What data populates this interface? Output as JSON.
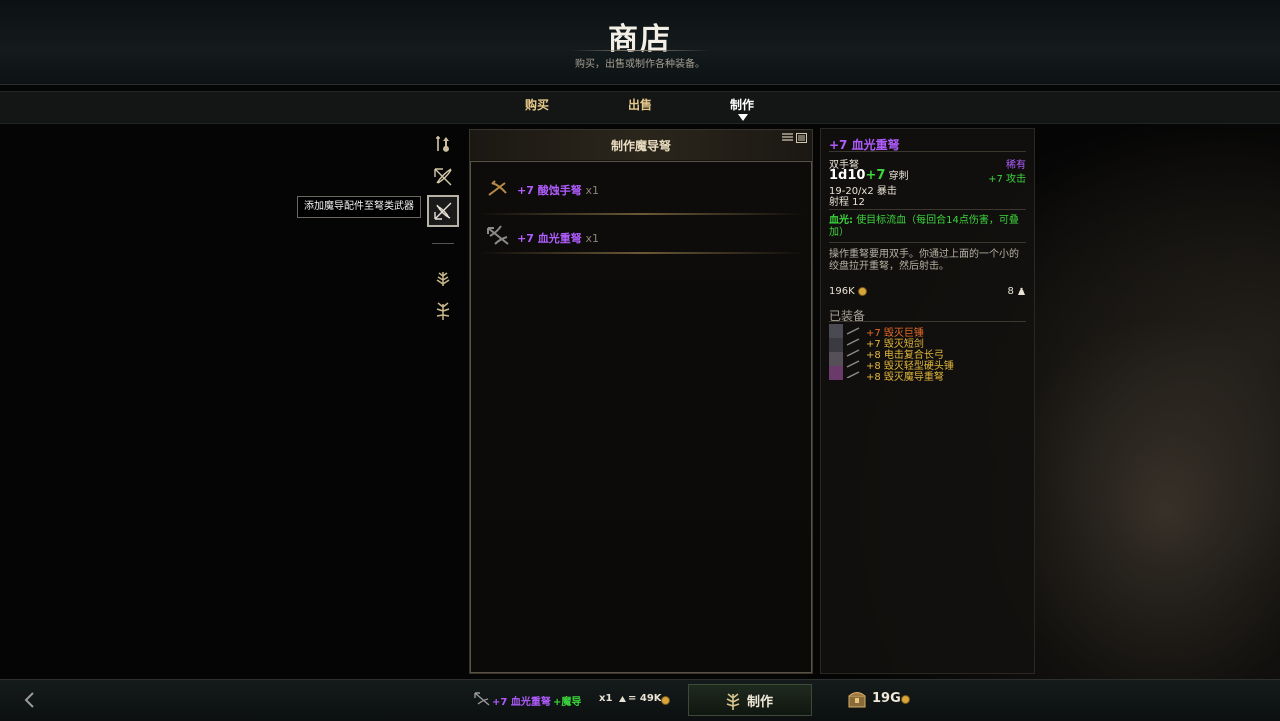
{
  "header": {
    "title": "商店",
    "subtitle": "购买，出售或制作各种装备。"
  },
  "tabs": [
    {
      "label": "购买",
      "active": false
    },
    {
      "label": "出售",
      "active": false
    },
    {
      "label": "制作",
      "active": true
    }
  ],
  "categories": {
    "icons": [
      "potion-sword-icon",
      "crossbow-icon",
      "magic-crossbow-icon",
      "wheat-icon",
      "herb-icon"
    ],
    "selected": "magic-crossbow-icon",
    "tooltip": "添加魔导配件至弩类武器"
  },
  "craft_panel": {
    "title": "制作魔导弩",
    "items": [
      {
        "name": "+7 酸蚀手弩",
        "qty": "x1"
      },
      {
        "name": "+7 血光重弩",
        "qty": "x1"
      }
    ]
  },
  "detail": {
    "name": "+7 血光重弩",
    "type": "双手弩",
    "rarity": "稀有",
    "damage_base": "1d10",
    "damage_bonus": "+7",
    "damage_type": "穿刺",
    "attack_bonus": "+7 攻击",
    "crit": "19-20/x2 暴击",
    "range": "射程 12",
    "ability_label": "血光:",
    "ability_text": "使目标流血（每回合14点伤害，可叠加）",
    "description": "操作重弩要用双手。你通过上面的一个小的绞盘拉开重弩，然后射击。",
    "price": "196K",
    "weight": "8",
    "equipped_label": "已装备",
    "equipped": [
      {
        "name": "+7 毁灭巨锤",
        "color": "#e86a2a"
      },
      {
        "name": "+7 毁灭短剑",
        "color": "#e3b63c"
      },
      {
        "name": "+8 电击复合长弓",
        "color": "#e3b63c"
      },
      {
        "name": "+8 毁灭轻型硬头锤",
        "color": "#e3b63c"
      },
      {
        "name": "+8 毁灭魔导重弩",
        "color": "#e3b63c"
      }
    ]
  },
  "bottom": {
    "recipe_item": "+7 血光重弩",
    "recipe_addon": "+魔导",
    "qty": "x1",
    "cost": "= 49K",
    "craft_label": "制作",
    "gold": "19G"
  },
  "colors": {
    "epic": "#b05cff",
    "green": "#3cd63c",
    "gold_text": "#e6c98a",
    "orange": "#e86a2a",
    "yellow": "#e3b63c"
  }
}
